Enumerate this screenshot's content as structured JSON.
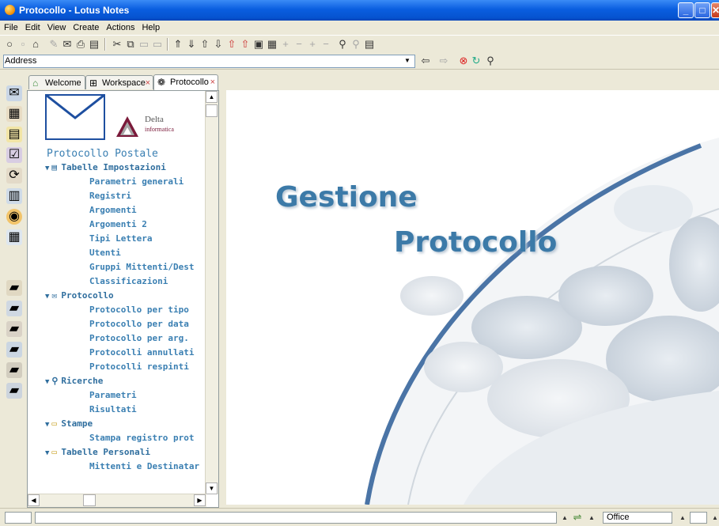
{
  "window": {
    "title": "Protocollo - Lotus Notes",
    "min": "_",
    "max": "□",
    "close": "✕"
  },
  "menu": [
    "File",
    "Edit",
    "View",
    "Create",
    "Actions",
    "Help"
  ],
  "address": {
    "label": "Address",
    "value": ""
  },
  "tabs": [
    {
      "label": "Welcome",
      "icon": "home-icon",
      "closable": false
    },
    {
      "label": "Workspace",
      "icon": "workspace-icon",
      "closable": true
    },
    {
      "label": "Protocollo",
      "icon": "database-icon",
      "closable": true,
      "active": true
    }
  ],
  "logo": {
    "company": "Delta",
    "subtitle": "informatica"
  },
  "nav": {
    "title": "Protocollo Postale",
    "sections": [
      {
        "label": "Tabelle Impostazioni",
        "icon": "table-icon",
        "items": [
          "Parametri generali",
          "Registri",
          "Argomenti",
          "Argomenti 2",
          "Tipi Lettera",
          "Utenti",
          "Gruppi Mittenti/Dest",
          "Classificazioni"
        ]
      },
      {
        "label": "Protocollo",
        "icon": "envelope-icon",
        "items": [
          "Protocollo per tipo",
          "Protocollo per data",
          "Protocollo per arg.",
          "Protocolli annullati",
          "Protocolli respinti"
        ]
      },
      {
        "label": "Ricerche",
        "icon": "search-icon",
        "items": [
          "Parametri",
          "Risultati"
        ]
      },
      {
        "label": "Stampe",
        "icon": "folder-icon",
        "items": [
          "Stampa registro prot"
        ]
      },
      {
        "label": "Tabelle Personali",
        "icon": "folder-icon",
        "items": [
          "Mittenti e Destinatar"
        ]
      }
    ]
  },
  "content": {
    "heading_line1": "Gestione",
    "heading_line2": "Protocollo"
  },
  "status": {
    "location": "Office"
  },
  "colors": {
    "titlebar": "#0a5ee0",
    "nav_text": "#3a7fb2",
    "heading": "#3c7aa8"
  }
}
